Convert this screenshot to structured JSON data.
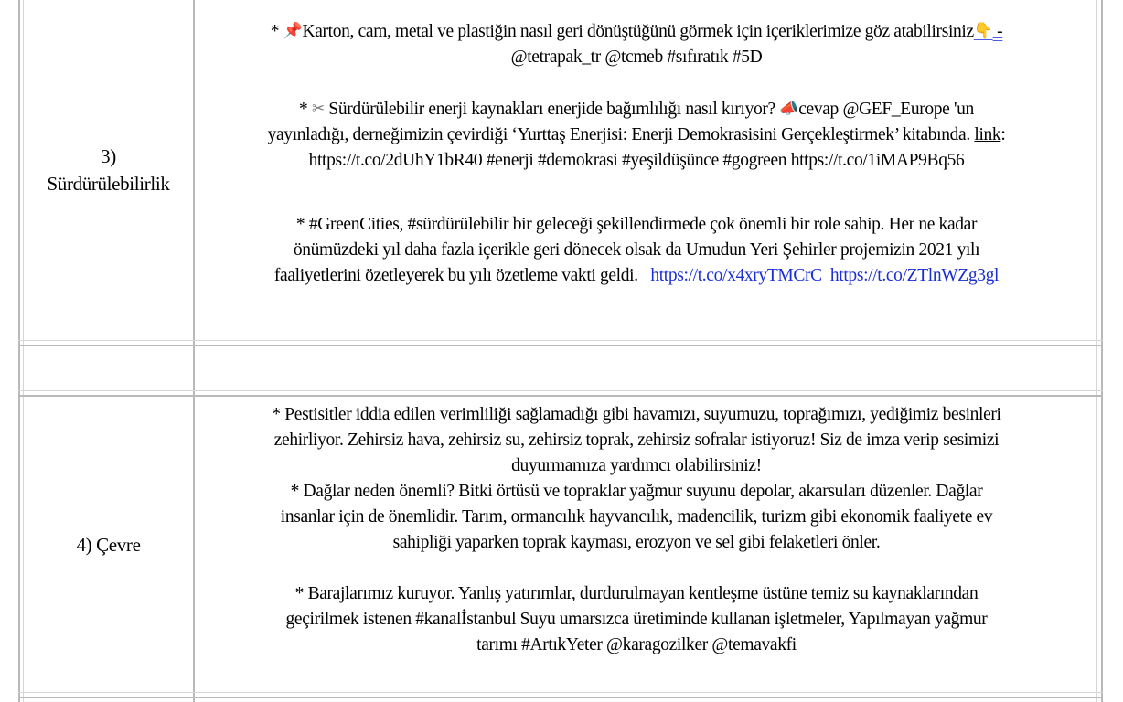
{
  "rows": [
    {
      "label": "3) Sürdürülebilirlik",
      "label_lines": [
        "3)",
        "Sürdürülebilirlik"
      ],
      "paragraphs": {
        "p1_prefix": "* ",
        "p1_icon": "pushpin-icon",
        "p1_text": "Karton, cam, metal ve plastiğin nasıl geri dönüştüğünü görmek için içeriklerimize göz atabilirsiniz",
        "p1_icon2": "pointing-down-icon",
        "p1_dash": " -",
        "p1_line2": "@tetrapak_tr @tcmeb #sıfıratık #5D",
        "p2_prefix": "* ",
        "p2_icon": "scissors-icon",
        "p2_text": " Sürdürülebilir enerji kaynakları enerjide bağımlılığı nasıl kırıyor? ",
        "p2_icon2": "megaphone-icon",
        "p2_after": "cevap @GEF_Europe 'un",
        "p2_line2": "yayınladığı, derneğimizin çevirdiği ‘Yurttaş Enerjisi: Enerji Demokrasisini Gerçekleştirmek’ kitabında. ",
        "p2_link": "link",
        "p2_colon": ":",
        "p2_line3": "https://t.co/2dUhY1bR40 #enerji #demokrasi #yeşildüşünce #gogreen https://t.co/1iMAP9Bq56",
        "p3_line1": "* #GreenCities, #sürdürülebilir bir geleceği şekillendirmede çok önemli bir role sahip. Her ne kadar",
        "p3_line2": "önümüzdeki yıl daha fazla içerikle geri dönecek olsak da Umudun Yeri Şehirler projemizin 2021 yılı",
        "p3_line3": "faaliyetlerini özetleyerek bu yılı özetleme vakti geldi.   ",
        "p3_link1": "https://t.co/x4xryTMCrC",
        "p3_link2": "https://t.co/ZTlnWZg3gl"
      }
    },
    {
      "label": "",
      "empty": true
    },
    {
      "label": "4) Çevre",
      "lines": [
        "* Pestisitler iddia edilen verimliliği sağlamadığı gibi havamızı, suyumuzu, toprağımızı, yediğimiz besinleri",
        "zehirliyor. Zehirsiz hava, zehirsiz su, zehirsiz toprak, zehirsiz sofralar istiyoruz! Siz de imza verip sesimizi",
        "duyurmamıza yardımcı olabilirsiniz!",
        "* Dağlar neden önemli? Bitki örtüsü ve topraklar yağmur suyunu depolar, akarsuları düzenler. Dağlar",
        "insanlar için de önemlidir. Tarım, ormancılık hayvancılık, madencilik, turizm gibi ekonomik faaliyete ev",
        "sahipliği yaparken toprak kayması, erozyon ve sel gibi felaketleri önler.",
        "* Barajlarımız kuruyor. Yanlış yatırımlar, durdurulmayan kentleşme üstüne temiz su kaynaklarından",
        "geçirilmek istenen #kanalİstanbul Suyu umarsızca üretiminde kullanan işletmeler, Yapılmayan yağmur",
        "tarımı #ArtıkYeter @karagozilker @temavakfi"
      ]
    }
  ]
}
